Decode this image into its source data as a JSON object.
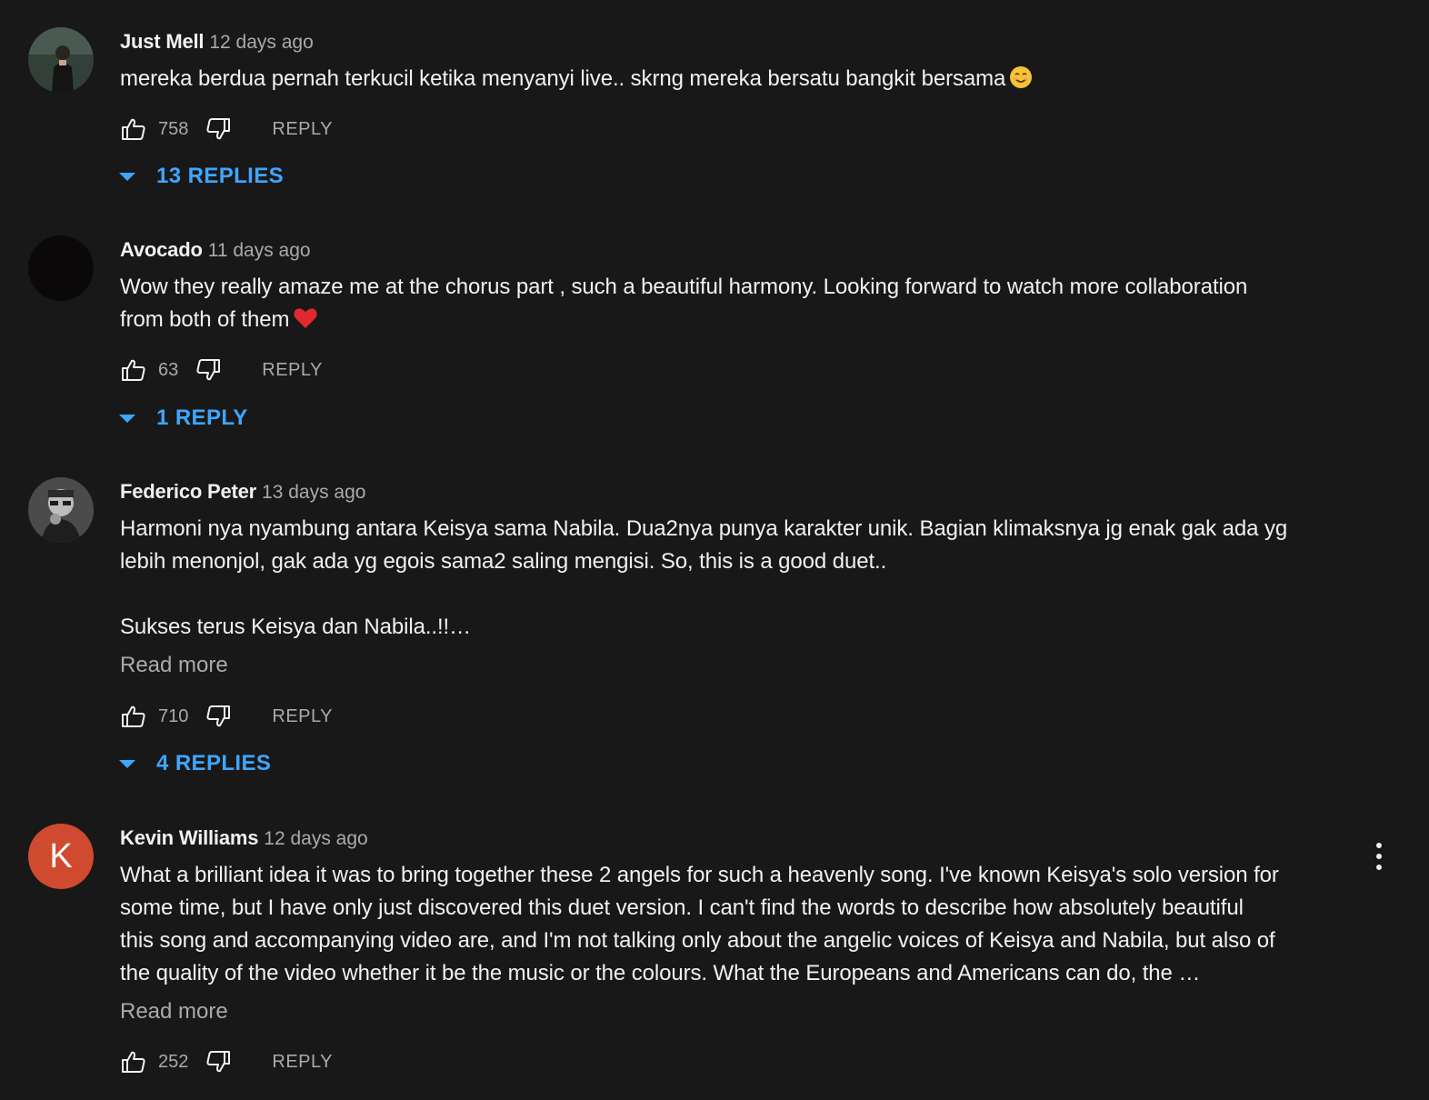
{
  "comments": [
    {
      "author": "Just Mell",
      "time": "12 days ago",
      "text": "mereka berdua pernah terkucil ketika menyanyi live.. skrng mereka bersatu bangkit bersama",
      "emoji": "smiling-face",
      "likes": "758",
      "reply_label": "REPLY",
      "replies_label": "13 REPLIES",
      "avatar": "photo-person-icon"
    },
    {
      "author": "Avocado",
      "time": "11 days ago",
      "text_line1": "Wow they really amaze me at the chorus part , such a beautiful harmony. Looking forward to watch more collaboration",
      "text_line2": "from both of them",
      "emoji": "red-heart",
      "likes": "63",
      "reply_label": "REPLY",
      "replies_label": "1 REPLY",
      "avatar": "dark-avatar-icon"
    },
    {
      "author": "Federico Peter",
      "time": "13 days ago",
      "text": "Harmoni nya nyambung antara Keisya sama Nabila. Dua2nya punya karakter unik. Bagian klimaksnya jg enak gak ada yg\nlebih menonjol, gak ada yg egois sama2 saling mengisi. So, this is a good duet..\n\nSukses terus Keisya dan Nabila..!!…",
      "read_more": "Read more",
      "likes": "710",
      "reply_label": "REPLY",
      "replies_label": "4 REPLIES",
      "avatar": "photo-person-icon"
    },
    {
      "author": "Kevin Williams",
      "time": "12 days ago",
      "text": "What a brilliant idea it was to bring together these 2 angels for such a heavenly song. I've known Keisya's solo version for\nsome time, but I have only just discovered this duet version. I can't find the words to describe how absolutely beautiful\nthis song and accompanying video are, and I'm not talking only about the angelic voices of Keisya and Nabila, but also of\nthe quality of the video whether it be the music or the colours. What the Europeans and Americans can do, the …",
      "read_more": "Read more",
      "likes": "252",
      "reply_label": "REPLY",
      "avatar_letter": "K",
      "avatar_color": "#d04a2f"
    }
  ],
  "colors": {
    "background": "#181818",
    "text": "#f1f1f1",
    "secondary": "#aaaaaa",
    "link_blue": "#3ea6ff"
  }
}
